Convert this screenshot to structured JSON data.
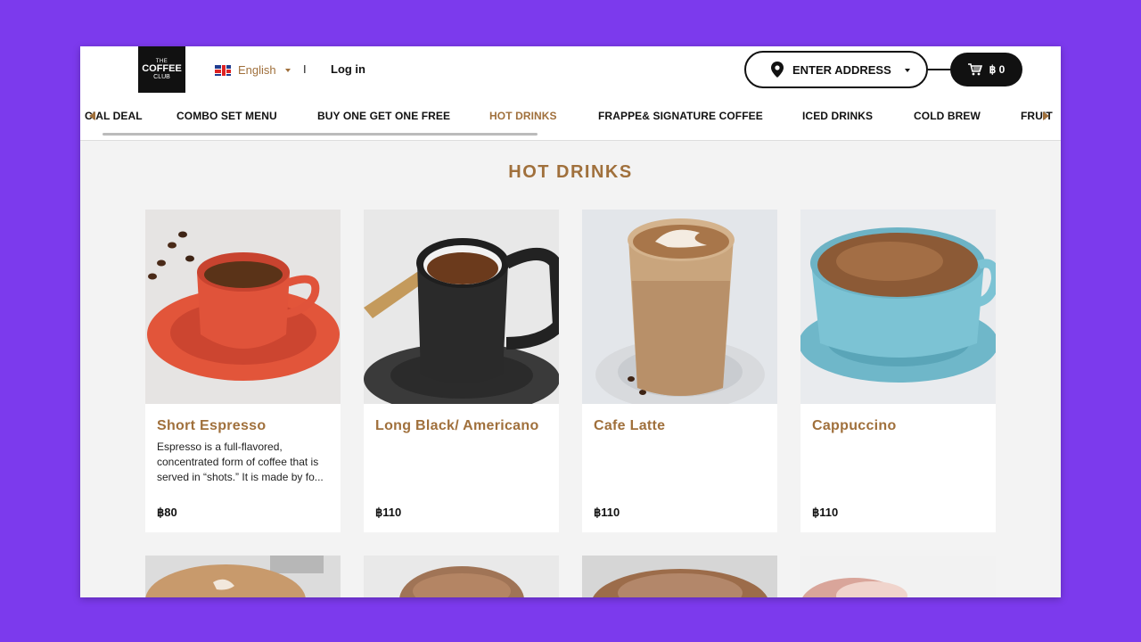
{
  "header": {
    "logo": {
      "line1": "THE",
      "line2": "COFFEE",
      "line3": "CLUB"
    },
    "language": "English",
    "separator": "I",
    "login": "Log in",
    "address_button": "ENTER ADDRESS",
    "cart_total": "฿ 0"
  },
  "nav": {
    "items": [
      {
        "label": "CIAL DEAL"
      },
      {
        "label": "COMBO SET MENU"
      },
      {
        "label": "BUY ONE GET ONE FREE"
      },
      {
        "label": "HOT DRINKS"
      },
      {
        "label": "FRAPPE& SIGNATURE COFFEE"
      },
      {
        "label": "ICED DRINKS"
      },
      {
        "label": "COLD BREW"
      },
      {
        "label": "FRUIT"
      }
    ],
    "active": "HOT DRINKS"
  },
  "section": {
    "title": "HOT DRINKS"
  },
  "products": [
    {
      "name": "Short Espresso",
      "description": "Espresso is a full-flavored, concentrated form of coffee that is served in “shots.” It is made by fo...",
      "price": "฿80"
    },
    {
      "name": "Long Black/ Americano",
      "description": "",
      "price": "฿110"
    },
    {
      "name": "Cafe Latte",
      "description": "",
      "price": "฿110"
    },
    {
      "name": "Cappuccino",
      "description": "",
      "price": "฿110"
    }
  ],
  "colors": {
    "accent": "#a0703c",
    "background": "#7c3aed",
    "page": "#f3f3f3"
  },
  "icons": [
    "uk-flag-icon",
    "location-pin-icon",
    "cart-icon",
    "chevron-down-icon",
    "arrow-left-icon",
    "arrow-right-icon"
  ]
}
